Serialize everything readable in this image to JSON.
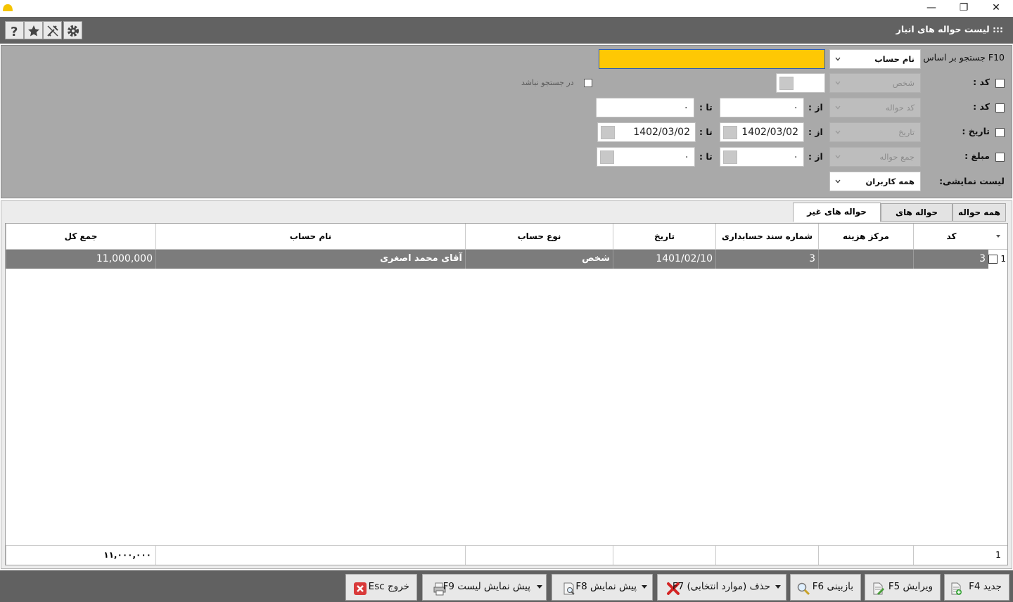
{
  "window": {
    "minimize": "—",
    "restore": "❐",
    "close": "✕"
  },
  "header": {
    "title": ":::  لیست حواله های انبار",
    "tools": [
      "help-icon",
      "star-icon",
      "tools-icon",
      "gear-icon"
    ]
  },
  "search": {
    "search_by_label": "F10  جستجو بر اساس :",
    "search_by_value": "نام حساب",
    "search_input_value": "",
    "row1": {
      "label": "کد :",
      "combo": "شخص",
      "exclude_label": "در جستجو نباشد"
    },
    "row2": {
      "label": "کد :",
      "combo": "کد حواله",
      "from_label": "از :",
      "from_value": "۰",
      "to_label": "تا :",
      "to_value": "۰"
    },
    "row3": {
      "label": "تاریخ  :",
      "combo": "تاریخ",
      "from_label": "از :",
      "from_value": "1402/03/02",
      "to_label": "تا :",
      "to_value": "1402/03/02"
    },
    "row4": {
      "label": "مبلغ :",
      "combo": "جمع حواله",
      "from_label": "از :",
      "from_value": "۰",
      "to_label": "تا :",
      "to_value": "۰"
    },
    "row5": {
      "label": "لیست نمایشی:",
      "combo": "همه کاربران"
    }
  },
  "tabs": [
    {
      "label": "همه حواله ها",
      "active": false
    },
    {
      "label": "حواله های اتومات",
      "active": false
    },
    {
      "label": "حواله های غیر اتومات",
      "active": true
    }
  ],
  "grid": {
    "columns": {
      "code": "کد",
      "cost_center": "مرکز هزینه",
      "doc_number": "شماره سند حسابداری",
      "date": "تاریخ",
      "account_type": "نوع حساب",
      "account_name": "نام حساب",
      "total": "جمع کل"
    },
    "rows": [
      {
        "index": "1",
        "code": "3",
        "cost_center": "",
        "doc_number": "3",
        "date": "1401/02/10",
        "account_type": "شخص",
        "account_name": "آقای محمد اصغری",
        "total": "11,000,000"
      }
    ],
    "footer": {
      "count": "1",
      "total": "۱۱,۰۰۰,۰۰۰"
    }
  },
  "buttons": {
    "new": "جدید F4",
    "edit": "ویرایش F5",
    "review": "بازبینی F6",
    "delete": "حذف (موارد انتخابی) F7",
    "preview": "پیش نمایش F8",
    "list_preview": "پیش نمایش لیست F9",
    "exit": "خروج Esc"
  },
  "colors": {
    "header_bg": "#626262",
    "panel_bg": "#a9a9a9",
    "search_highlight": "#fec804",
    "selected_row": "#7c7c7c"
  }
}
